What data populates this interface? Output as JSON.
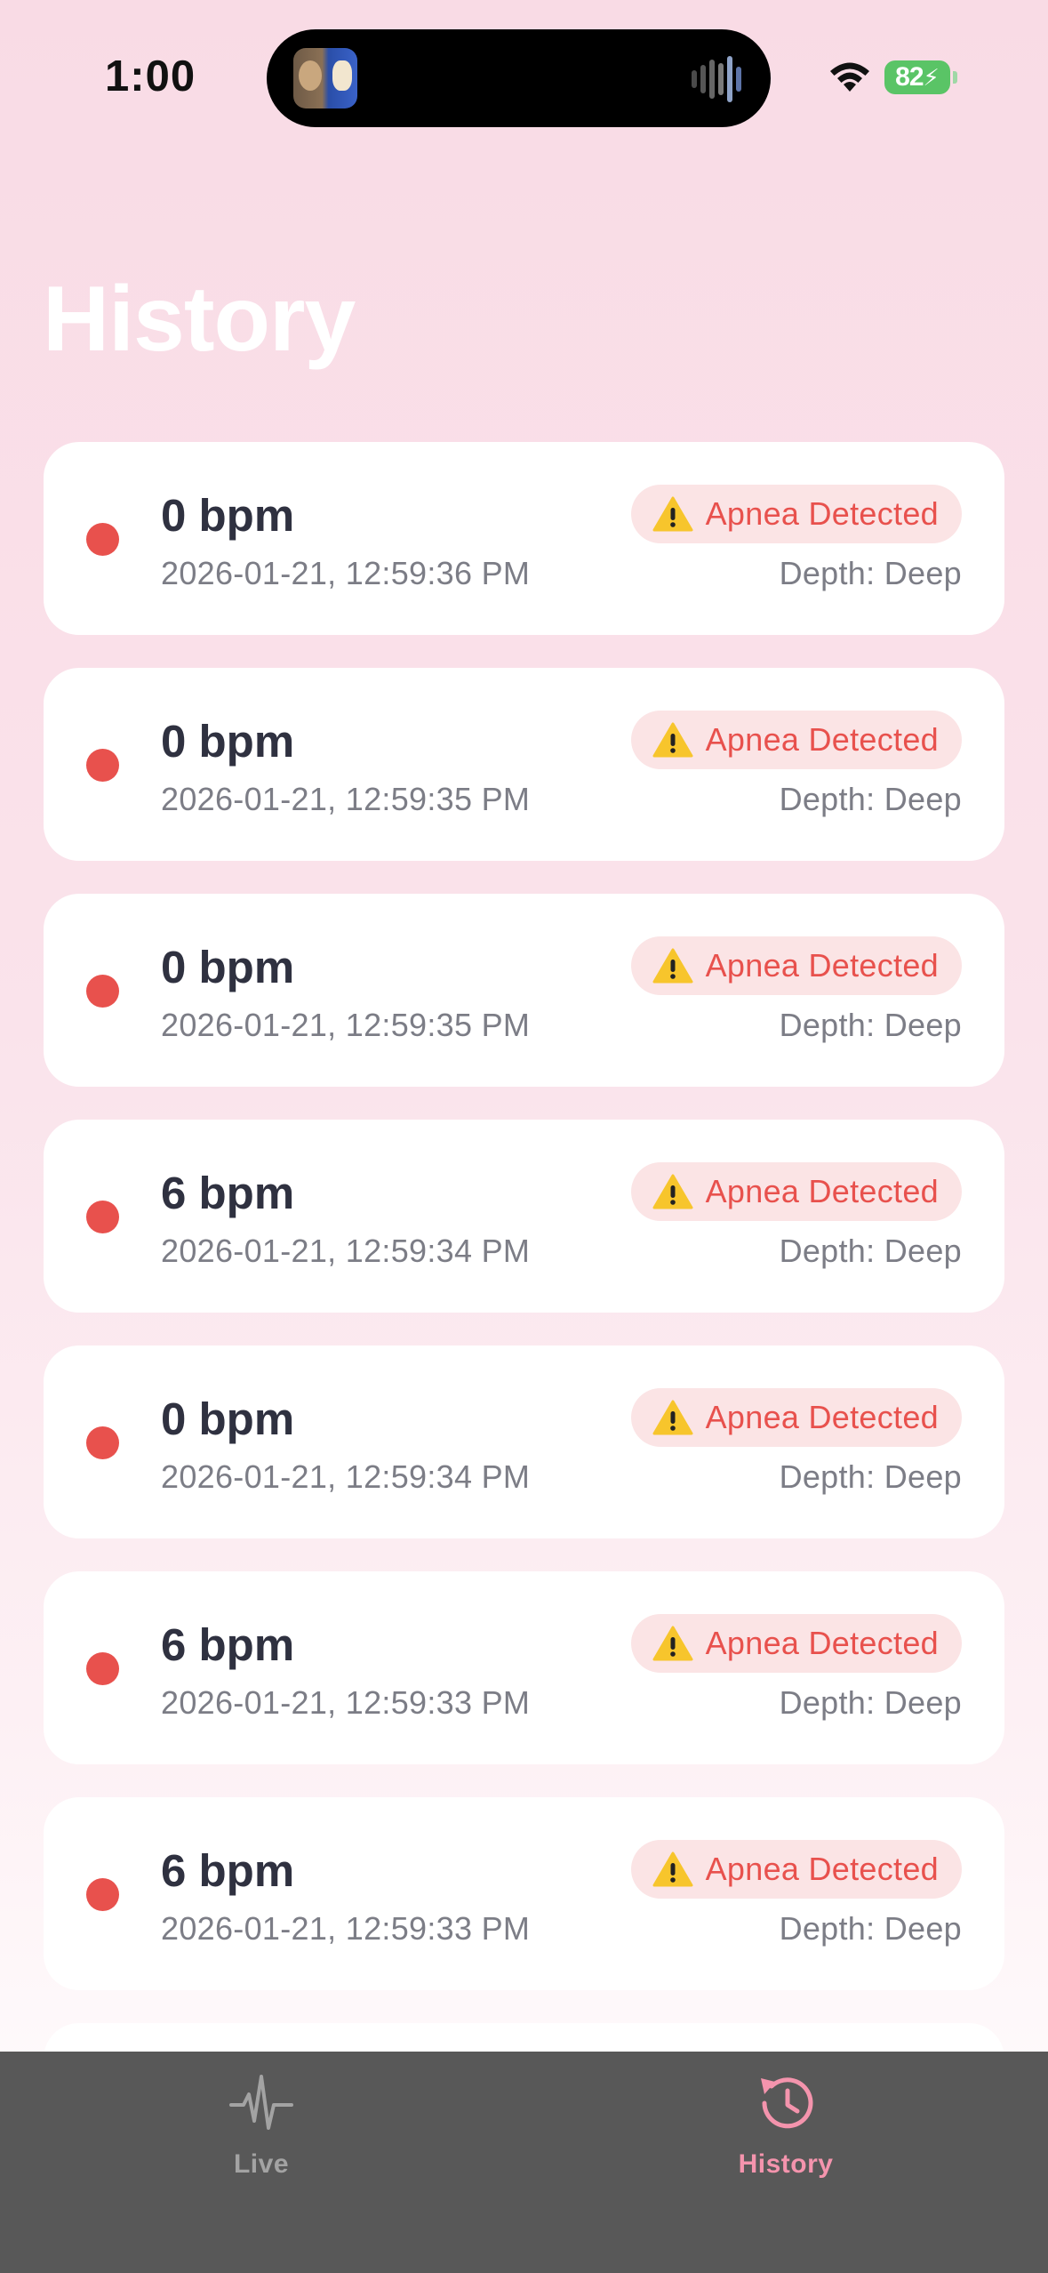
{
  "status_bar": {
    "time": "1:00",
    "battery": "82"
  },
  "page": {
    "title": "History"
  },
  "history": [
    {
      "bpm": "0 bpm",
      "timestamp": "2026-01-21, 12:59:36 PM",
      "badge": "Apnea Detected",
      "depth": "Depth: Deep"
    },
    {
      "bpm": "0 bpm",
      "timestamp": "2026-01-21, 12:59:35 PM",
      "badge": "Apnea Detected",
      "depth": "Depth: Deep"
    },
    {
      "bpm": "0 bpm",
      "timestamp": "2026-01-21, 12:59:35 PM",
      "badge": "Apnea Detected",
      "depth": "Depth: Deep"
    },
    {
      "bpm": "6 bpm",
      "timestamp": "2026-01-21, 12:59:34 PM",
      "badge": "Apnea Detected",
      "depth": "Depth: Deep"
    },
    {
      "bpm": "0 bpm",
      "timestamp": "2026-01-21, 12:59:34 PM",
      "badge": "Apnea Detected",
      "depth": "Depth: Deep"
    },
    {
      "bpm": "6 bpm",
      "timestamp": "2026-01-21, 12:59:33 PM",
      "badge": "Apnea Detected",
      "depth": "Depth: Deep"
    },
    {
      "bpm": "6 bpm",
      "timestamp": "2026-01-21, 12:59:33 PM",
      "badge": "Apnea Detected",
      "depth": "Depth: Deep"
    },
    {
      "bpm": "",
      "timestamp": "",
      "badge": "",
      "depth": ""
    }
  ],
  "tab_bar": {
    "tabs": [
      {
        "label": "Live",
        "icon": "waveform-pulse-icon",
        "active": false
      },
      {
        "label": "History",
        "icon": "clock-history-icon",
        "active": true
      }
    ]
  },
  "colors": {
    "alert": "#e8514d",
    "badge_bg": "#fbe4e5",
    "active_tab": "#f494ad",
    "inactive_tab": "#a3a3a3",
    "tab_bar_bg": "#585858"
  }
}
